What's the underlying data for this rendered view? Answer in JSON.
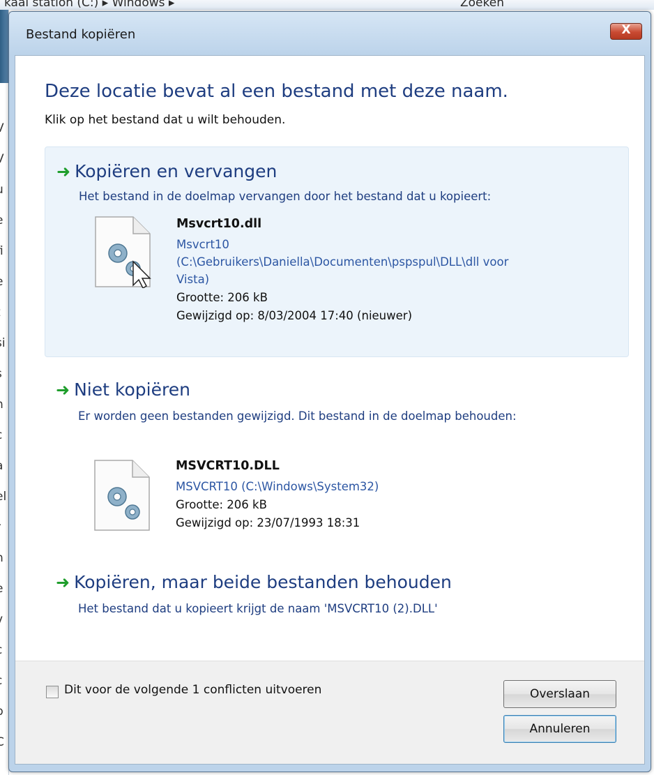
{
  "background": {
    "top_text": "kaal station (C:) ▸ Windows ▸",
    "search_text": "Zoeken",
    "left_fragments": [
      "V",
      "V",
      "u",
      "e",
      "fi",
      "e",
      "t",
      "si",
      "s",
      "n",
      "c",
      "a",
      "el",
      "r",
      "n",
      "e",
      "v",
      "c",
      "c",
      "b",
      "C"
    ]
  },
  "dialog": {
    "title": "Bestand kopiëren",
    "close_label": "X",
    "heading": "Deze locatie bevat al een bestand met deze naam.",
    "subheading": "Klik op het bestand dat u wilt behouden.",
    "options": [
      {
        "title": "Kopiëren en vervangen",
        "description": "Het bestand in de doelmap vervangen door het bestand dat u kopieert:",
        "file": {
          "name": "Msvcrt10.dll",
          "location_lines": [
            "Msvcrt10",
            "(C:\\Gebruikers\\Daniella\\Documenten\\pspspul\\DLL\\dll voor",
            "Vista)"
          ],
          "size": "Grootte: 206 kB",
          "modified": "Gewijzigd op: 8/03/2004 17:40 (nieuwer)"
        }
      },
      {
        "title": "Niet kopiëren",
        "description": "Er worden geen bestanden gewijzigd. Dit bestand in de doelmap behouden:",
        "file": {
          "name": "MSVCRT10.DLL",
          "location_lines": [
            "MSVCRT10 (C:\\Windows\\System32)"
          ],
          "size": "Grootte: 206 kB",
          "modified": "Gewijzigd op: 23/07/1993 18:31"
        }
      },
      {
        "title": "Kopiëren, maar beide bestanden behouden",
        "description": "Het bestand dat u kopieert krijgt de naam 'MSVCRT10 (2).DLL'"
      }
    ],
    "footer": {
      "checkbox_label": "Dit voor de volgende 1 conflicten uitvoeren",
      "checkbox_checked": false,
      "skip_button": "Overslaan",
      "cancel_button": "Annuleren"
    }
  },
  "colors": {
    "heading_blue": "#1e3d80",
    "link_blue": "#2c56a3",
    "arrow_green": "#1f9e2c",
    "hover_bg": "#ecf4fb"
  }
}
